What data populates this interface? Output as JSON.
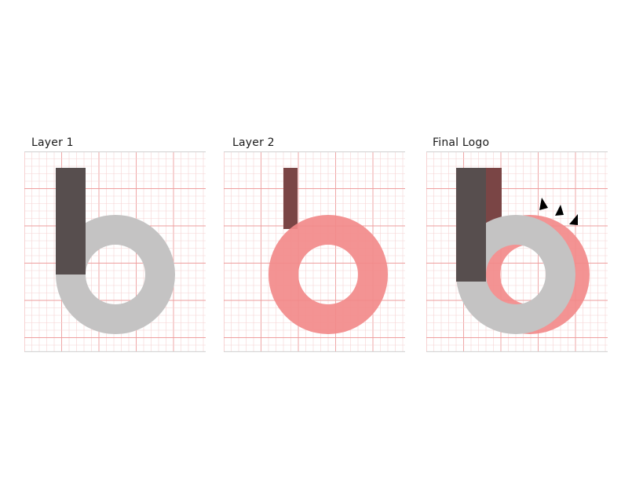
{
  "panels": {
    "layer1": {
      "title": "Layer 1"
    },
    "layer2": {
      "title": "Layer 2"
    },
    "final": {
      "title": "Final Logo"
    }
  },
  "colors": {
    "grid_minor": "#f6d3d3",
    "grid_major": "#ee9e9e",
    "stem_dark": "#574e4e",
    "stem_maroon": "#7a4545",
    "ring_gray": "#c4c3c3",
    "ring_pink": "#f28a8a",
    "arrow": "#000000",
    "frame": "#d6d6d6"
  },
  "icons": {
    "shadow_arrows": "arrowhead-icon"
  }
}
